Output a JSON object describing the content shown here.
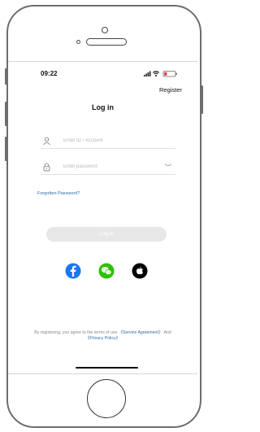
{
  "status_bar": {
    "time": "09:22",
    "icons": [
      "signal-icon",
      "wifi-icon",
      "battery-icon"
    ]
  },
  "header": {
    "register_label": "Register",
    "title": "Log in"
  },
  "form": {
    "account_placeholder": "Enter ID / Account",
    "account_value": "",
    "account_icon": "user-icon",
    "password_placeholder": "Enter password",
    "password_value": "",
    "password_icon": "lock-icon",
    "password_toggle_icon": "eye-closed-icon",
    "forgot_label": "Forgotten Password?",
    "login_label": "Log in"
  },
  "social": {
    "items": [
      {
        "name": "facebook-icon",
        "color": "#1877f2"
      },
      {
        "name": "wechat-icon",
        "color": "#2dc100"
      },
      {
        "name": "apple-icon",
        "color": "#000000"
      }
    ]
  },
  "footer": {
    "text_before": "By registering, you agree to the terms of use ",
    "service_link": "《Service Agreement》",
    "and_text": " And ",
    "privacy_link": "《Privacy Policy》"
  },
  "colors": {
    "link": "#2d6fa7",
    "button_disabled": "#e7e7e7",
    "frame": "#6d6d6d"
  }
}
